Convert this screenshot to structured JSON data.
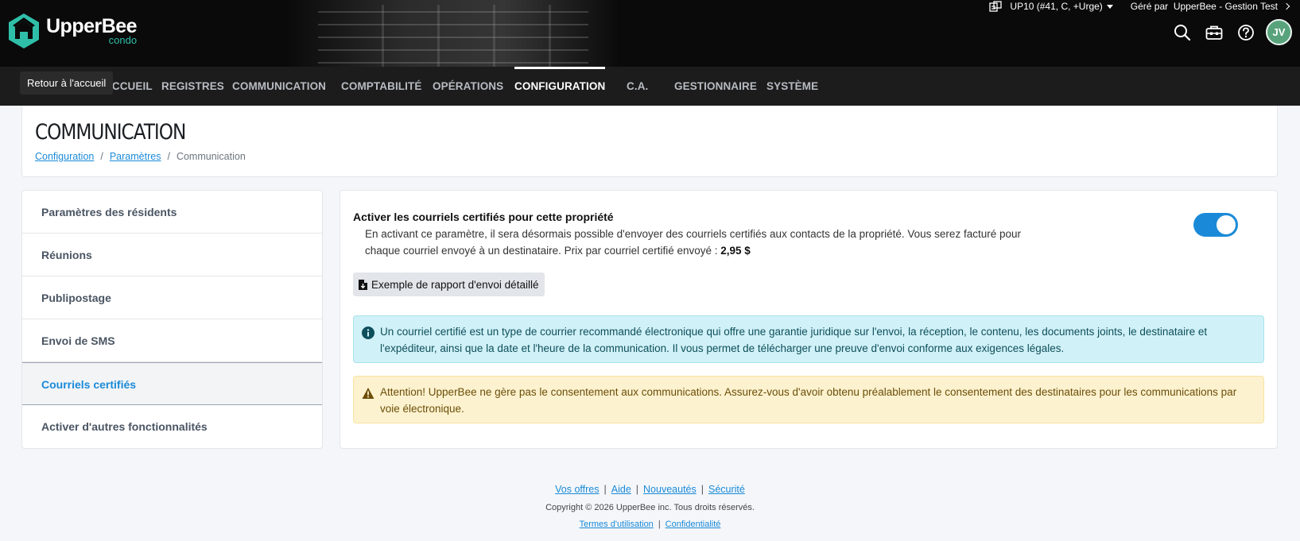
{
  "header": {
    "brand": "UpperBee",
    "brand_sub": "condo",
    "property_selector": "UP10 (#41, C, +Urge)",
    "managed_by": "Géré par  UpperBee - Gestion Test",
    "avatar_initials": "JV",
    "home_tooltip": "Retour à l'accueil",
    "icons": [
      "search-icon",
      "toolbox-icon",
      "help-icon"
    ]
  },
  "nav": {
    "items": [
      {
        "label": "ACCUEIL"
      },
      {
        "label": "REGISTRES"
      },
      {
        "label": "COMMUNICATION"
      },
      {
        "label": "COMPTABILITÉ"
      },
      {
        "label": "OPÉRATIONS"
      },
      {
        "label": "CONFIGURATION",
        "active": true
      },
      {
        "label": "C.A."
      },
      {
        "label": "GESTIONNAIRE"
      },
      {
        "label": "SYSTÈME"
      }
    ]
  },
  "page": {
    "title": "COMMUNICATION",
    "breadcrumb": [
      "Configuration",
      "Paramètres",
      "Communication"
    ]
  },
  "sidebar": {
    "items": [
      {
        "label": "Paramètres des résidents"
      },
      {
        "label": "Réunions"
      },
      {
        "label": "Publipostage"
      },
      {
        "label": "Envoi de SMS"
      },
      {
        "label": "Courriels certifiés",
        "active": true
      },
      {
        "label": "Activer d'autres fonctionnalités"
      }
    ]
  },
  "main": {
    "setting_title": "Activer les courriels certifiés pour cette propriété",
    "setting_desc": "En activant ce paramètre, il sera désormais possible d'envoyer des courriels certifiés aux contacts de la propriété. Vous serez facturé pour chaque courriel envoyé à un destinataire. Prix par courriel certifié envoyé :",
    "price": "2,95 $",
    "toggle_on": true,
    "example_button": "Exemple de rapport d'envoi détaillé",
    "info_text": "Un courriel certifié est un type de courrier recommandé électronique qui offre une garantie juridique sur l'envoi, la réception, le contenu, les documents joints, le destinataire et l'expéditeur, ainsi que la date et l'heure de la communication. Il vous permet de télécharger une preuve d'envoi conforme aux exigences légales.",
    "warning_text": "Attention! UpperBee ne gère pas le consentement aux communications. Assurez-vous d'avoir obtenu préalablement le consentement des destinataires pour les communications par voie électronique."
  },
  "footer": {
    "links": [
      "Vos offres",
      "Aide",
      "Nouveautés",
      "Sécurité"
    ],
    "copyright": "Copyright © 2026 UpperBee inc. Tous droits réservés.",
    "legal": [
      "Termes d'utilisation",
      "Confidentialité"
    ]
  },
  "colors": {
    "accent": "#1a8ad8",
    "brand_teal": "#2fbfa9",
    "info_bg": "#d0f1f7",
    "warning_bg": "#fdf2cf"
  }
}
